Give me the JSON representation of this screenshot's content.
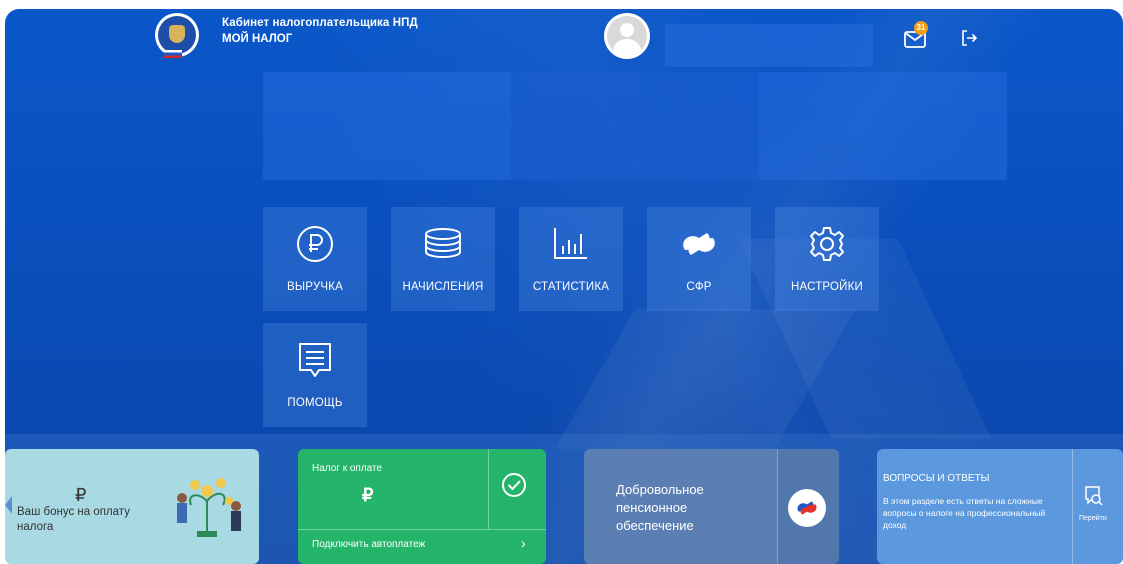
{
  "header": {
    "title_line1": "Кабинет налогоплательщика НПД",
    "title_line2": "МОЙ НАЛОГ",
    "logo_ring_text": "ФЕДЕРАЛЬНАЯ НАЛОГОВАЯ СЛУЖБА",
    "notification_count": "31"
  },
  "tiles": [
    {
      "label": "ВЫРУЧКА",
      "icon": "ruble-circle-icon"
    },
    {
      "label": "НАЧИСЛЕНИЯ",
      "icon": "coins-stack-icon"
    },
    {
      "label": "СТАТИСТИКА",
      "icon": "bar-chart-icon"
    },
    {
      "label": "СФР",
      "icon": "sfr-logo-icon"
    },
    {
      "label": "НАСТРОЙКИ",
      "icon": "gear-icon"
    },
    {
      "label": "ПОМОЩЬ",
      "icon": "chat-lines-icon"
    }
  ],
  "cards": {
    "bonus": {
      "currency": "₽",
      "text": "Ваш бонус на оплату налога"
    },
    "tax": {
      "title": "Налог к оплате",
      "currency": "₽",
      "autopay": "Подключить автоплатеж"
    },
    "pension": {
      "text": "Добровольное пенсионное обеспечение"
    },
    "faq": {
      "title": "ВОПРОСЫ И ОТВЕТЫ",
      "text": "В этом разделе есть ответы на сложные вопросы о налоге на профессиональный доход",
      "go": "Перейти"
    }
  },
  "colors": {
    "accent": "#0a52c4",
    "tax_card": "#25b56a",
    "bonus_card": "#a9d9e3",
    "pension_card": "#5b7fb3",
    "faq_card": "#5b98dd",
    "badge": "#f39c12"
  }
}
